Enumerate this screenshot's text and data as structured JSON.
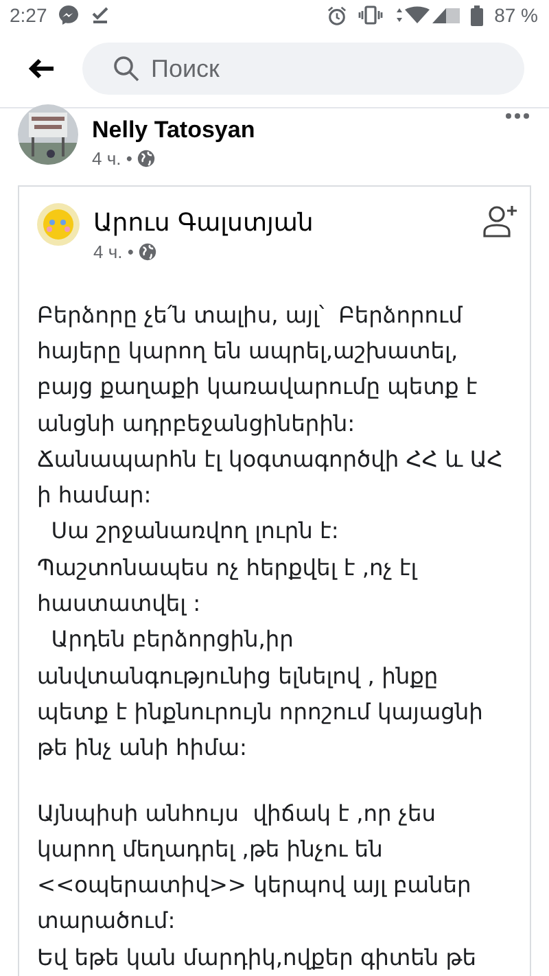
{
  "status_bar": {
    "time": "2:27",
    "battery": "87 %"
  },
  "search": {
    "placeholder": "Поиск"
  },
  "post": {
    "author": "Nelly Tatosyan",
    "meta": "4 ч. •"
  },
  "shared_post": {
    "author": "Արուս Գալստյան",
    "meta": "4 ч. •",
    "paragraphs": [
      {
        "lines": [
          "Բերձորը չե՛ն տալիս, այլ՝  Բերձորում",
          "հայերը կարող են ապրել,աշխատել,",
          "բայց քաղաքի կառավարումը պետք է",
          "անցնի ադրբեջանցիներին:",
          "Ճանապարհն էլ կօգտագործվի ՀՀ և ԱՀ",
          "ի համար:",
          "  Սա շրջանառվող լուրն է:",
          "Պաշտոնապես ոչ հերքվել է ,ոչ էլ",
          "հաստատվել :",
          "  Արդեն բերձորցին,իր",
          "անվտանգությունից ելնելով , ինքը",
          "պետք է ինքնուրույն որոշում կայացնի",
          "թե ինչ անի հիմա:"
        ]
      },
      {
        "lines": [
          "Այնպիսի անհույս  վիճակ է ,որ չես",
          "կարող մեղադրել ,թե ինչու են",
          "<<օպերատիվ>> կերպով այլ բաներ",
          "տարածում:",
          "Եվ եթե կան մարդիկ,ովքեր գիտեն թե"
        ]
      }
    ]
  }
}
